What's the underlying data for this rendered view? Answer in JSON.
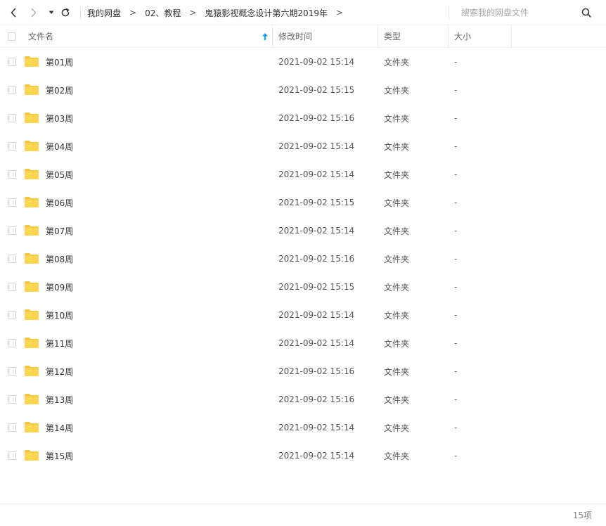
{
  "nav": {
    "back_icon": "chevron-left-icon",
    "forward_icon": "chevron-right-icon",
    "dropdown_icon": "caret-down-icon",
    "refresh_icon": "refresh-icon"
  },
  "breadcrumb": {
    "items": [
      "我的网盘",
      "02、教程",
      "鬼猿影视概念设计第六期2019年"
    ],
    "separator": ">"
  },
  "search": {
    "placeholder": "搜索我的网盘文件",
    "value": "",
    "icon": "search-icon"
  },
  "columns": {
    "name": "文件名",
    "mtime": "修改时间",
    "type": "类型",
    "size": "大小",
    "sort_icon": "sort-ascending-arrow-icon"
  },
  "files": [
    {
      "name": "第01周",
      "mtime": "2021-09-02 15:14",
      "type": "文件夹",
      "size": "-"
    },
    {
      "name": "第02周",
      "mtime": "2021-09-02 15:15",
      "type": "文件夹",
      "size": "-"
    },
    {
      "name": "第03周",
      "mtime": "2021-09-02 15:16",
      "type": "文件夹",
      "size": "-"
    },
    {
      "name": "第04周",
      "mtime": "2021-09-02 15:14",
      "type": "文件夹",
      "size": "-"
    },
    {
      "name": "第05周",
      "mtime": "2021-09-02 15:14",
      "type": "文件夹",
      "size": "-"
    },
    {
      "name": "第06周",
      "mtime": "2021-09-02 15:15",
      "type": "文件夹",
      "size": "-"
    },
    {
      "name": "第07周",
      "mtime": "2021-09-02 15:14",
      "type": "文件夹",
      "size": "-"
    },
    {
      "name": "第08周",
      "mtime": "2021-09-02 15:16",
      "type": "文件夹",
      "size": "-"
    },
    {
      "name": "第09周",
      "mtime": "2021-09-02 15:15",
      "type": "文件夹",
      "size": "-"
    },
    {
      "name": "第10周",
      "mtime": "2021-09-02 15:14",
      "type": "文件夹",
      "size": "-"
    },
    {
      "name": "第11周",
      "mtime": "2021-09-02 15:14",
      "type": "文件夹",
      "size": "-"
    },
    {
      "name": "第12周",
      "mtime": "2021-09-02 15:16",
      "type": "文件夹",
      "size": "-"
    },
    {
      "name": "第13周",
      "mtime": "2021-09-02 15:16",
      "type": "文件夹",
      "size": "-"
    },
    {
      "name": "第14周",
      "mtime": "2021-09-02 15:14",
      "type": "文件夹",
      "size": "-"
    },
    {
      "name": "第15周",
      "mtime": "2021-09-02 15:14",
      "type": "文件夹",
      "size": "-"
    }
  ],
  "footer": {
    "count_label": "15项"
  },
  "colors": {
    "folder": "#FFD54F",
    "folder_back": "#F5C23B",
    "sort_arrow": "#1E9FFF",
    "text": "#333333",
    "muted": "#888888"
  }
}
